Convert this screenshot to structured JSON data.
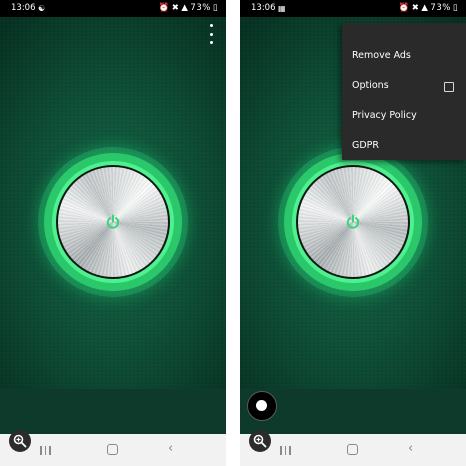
{
  "screens": [
    {
      "status_bar": {
        "time": "13:06",
        "left_icon": "wifi-icon",
        "battery": "73%"
      },
      "overflow_menu_open": false
    },
    {
      "status_bar": {
        "time": "13:06",
        "left_icon": "image-icon",
        "battery": "73%"
      },
      "overflow_menu_open": true,
      "menu": {
        "items": [
          {
            "label": "Remove Ads"
          },
          {
            "label": "Options",
            "checkbox": true,
            "checked": false
          },
          {
            "label": "Privacy Policy"
          },
          {
            "label": "GDPR"
          }
        ]
      }
    }
  ],
  "colors": {
    "background_green": "#0f5038",
    "ring_green": "#4ef08f",
    "menu_bg": "#2a2a2a"
  },
  "icons": [
    "power-icon",
    "overflow-menu-icon",
    "zoom-in-icon",
    "recents-icon",
    "home-icon",
    "back-icon",
    "record-icon"
  ]
}
